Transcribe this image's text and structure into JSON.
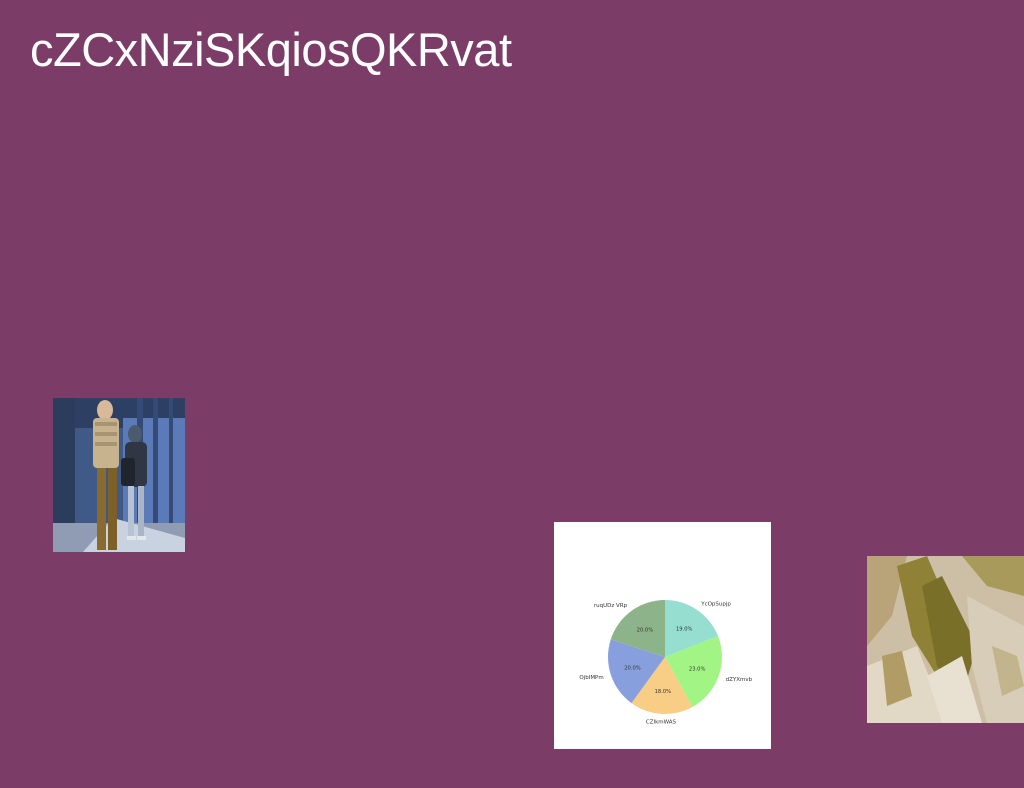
{
  "page": {
    "title": "cZCxNziSKqiosQKRvat",
    "background": "#7b3d68"
  },
  "images": {
    "people_photo": {
      "subject": "people-standing-photo"
    },
    "terrain_photo": {
      "subject": "eroded-terrain-photo"
    }
  },
  "chart_data": {
    "type": "pie",
    "title": "",
    "start_angle_deg": 90,
    "direction": "clockwise",
    "slices": [
      {
        "label": "YcOpSupjp",
        "value": 19.0,
        "pct_label": "19.0%",
        "color": "#96dfd0"
      },
      {
        "label": "dZYXmvb",
        "value": 23.0,
        "pct_label": "23.0%",
        "color": "#a2f585"
      },
      {
        "label": "CZIkmWAS",
        "value": 18.0,
        "pct_label": "18.0%",
        "color": "#f8cd85"
      },
      {
        "label": "OjbIMPm",
        "value": 20.0,
        "pct_label": "20.0%",
        "color": "#879fdc"
      },
      {
        "label": "ruqUDz VRp",
        "value": 20.0,
        "pct_label": "20.0%",
        "color": "#8db38a"
      }
    ]
  }
}
